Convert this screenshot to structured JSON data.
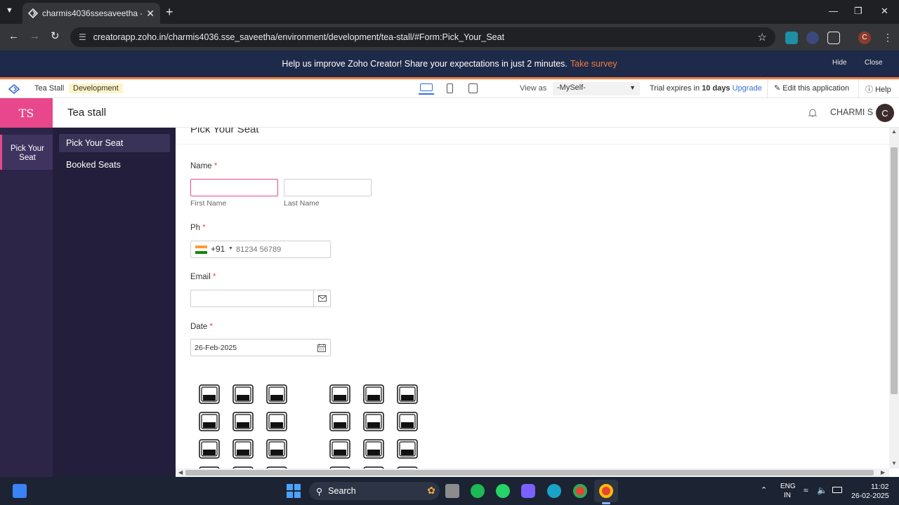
{
  "browser": {
    "tab_title": "charmis4036ssesaveetha - Tea",
    "url": "creatorapp.zoho.in/charmis4036.sse_saveetha/environment/development/tea-stall/#Form:Pick_Your_Seat",
    "profile_initial": "C"
  },
  "banner": {
    "message": "Help us improve Zoho Creator! Share your expectations in just 2 minutes.",
    "link": "Take survey",
    "hide": "Hide",
    "close": "Close"
  },
  "creator_bar": {
    "app_name": "Tea Stall",
    "environment": "Development",
    "view_as_label": "View as",
    "view_as_value": "-MySelf-",
    "trial_prefix": "Trial expires in",
    "trial_days": "10 days",
    "upgrade": "Upgrade",
    "edit": "Edit this application",
    "help": "Help"
  },
  "app_header": {
    "logo": "TS",
    "title": "Tea stall",
    "user": "CHARMI S",
    "avatar": "C"
  },
  "left_rail": {
    "active_label": "Pick Your Seat"
  },
  "subnav": {
    "items": [
      "Pick Your Seat",
      "Booked Seats"
    ]
  },
  "form": {
    "title": "Pick Your Seat",
    "name_label": "Name",
    "first_name": "First Name",
    "last_name": "Last Name",
    "phone_label": "Ph",
    "country_code": "+91",
    "phone_placeholder": "81234 56789",
    "email_label": "Email",
    "date_label": "Date",
    "date_value": "26-Feb-2025",
    "required_mark": "*"
  },
  "taskbar": {
    "search": "Search",
    "lang": "ENG",
    "region": "IN",
    "time": "11:02",
    "date": "26-02-2025"
  }
}
